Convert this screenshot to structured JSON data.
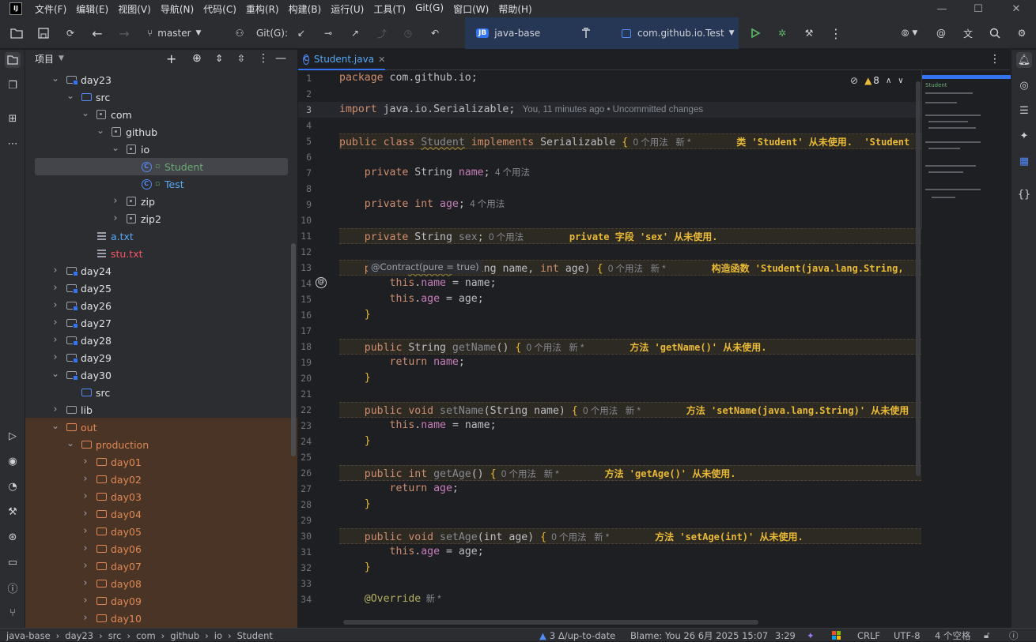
{
  "menu": [
    "文件(F)",
    "编辑(E)",
    "视图(V)",
    "导航(N)",
    "代码(C)",
    "重构(R)",
    "构建(B)",
    "运行(U)",
    "工具(T)",
    "Git(G)",
    "窗口(W)",
    "帮助(H)"
  ],
  "toolbar": {
    "branch": "master",
    "git_label": "Git(G):",
    "project_badge": "JB",
    "project_name": "java-base",
    "run_config": "com.github.io.Test"
  },
  "project_panel": {
    "title": "项目",
    "tree": [
      {
        "label": "day23",
        "type": "module",
        "depth": 1,
        "expanded": true,
        "color": "#dfe1e5"
      },
      {
        "label": "src",
        "type": "folder",
        "depth": 2,
        "expanded": true,
        "color": "#dfe1e5"
      },
      {
        "label": "com",
        "type": "package",
        "depth": 3,
        "expanded": true,
        "color": "#dfe1e5"
      },
      {
        "label": "github",
        "type": "package",
        "depth": 4,
        "expanded": true,
        "color": "#dfe1e5"
      },
      {
        "label": "io",
        "type": "package",
        "depth": 5,
        "expanded": true,
        "color": "#dfe1e5"
      },
      {
        "label": "Student",
        "type": "class",
        "depth": 6,
        "selected": true,
        "color": "#6aab73"
      },
      {
        "label": "Test",
        "type": "class",
        "depth": 6,
        "color": "#56a8f5"
      },
      {
        "label": "zip",
        "type": "package",
        "depth": 5,
        "expanded": false,
        "color": "#dfe1e5"
      },
      {
        "label": "zip2",
        "type": "package",
        "depth": 5,
        "expanded": false,
        "color": "#dfe1e5"
      },
      {
        "label": "a.txt",
        "type": "text",
        "depth": 3,
        "color": "#56a8f5"
      },
      {
        "label": "stu.txt",
        "type": "text",
        "depth": 3,
        "color": "#f75464"
      },
      {
        "label": "day24",
        "type": "module",
        "depth": 1,
        "expanded": false,
        "color": "#dfe1e5"
      },
      {
        "label": "day25",
        "type": "module",
        "depth": 1,
        "expanded": false,
        "color": "#dfe1e5"
      },
      {
        "label": "day26",
        "type": "module",
        "depth": 1,
        "expanded": false,
        "color": "#dfe1e5"
      },
      {
        "label": "day27",
        "type": "module",
        "depth": 1,
        "expanded": false,
        "color": "#dfe1e5"
      },
      {
        "label": "day28",
        "type": "module",
        "depth": 1,
        "expanded": false,
        "color": "#dfe1e5"
      },
      {
        "label": "day29",
        "type": "module",
        "depth": 1,
        "expanded": false,
        "color": "#dfe1e5"
      },
      {
        "label": "day30",
        "type": "module",
        "depth": 1,
        "expanded": true,
        "color": "#dfe1e5"
      },
      {
        "label": "src",
        "type": "folder",
        "depth": 2,
        "color": "#dfe1e5"
      },
      {
        "label": "lib",
        "type": "folder",
        "depth": 1,
        "expanded": false,
        "color": "#dfe1e5"
      },
      {
        "label": "out",
        "type": "folder-orange",
        "depth": 1,
        "expanded": true,
        "color": "#e08855"
      },
      {
        "label": "production",
        "type": "folder-orange",
        "depth": 2,
        "expanded": true,
        "color": "#e08855"
      },
      {
        "label": "day01",
        "type": "folder-orange",
        "depth": 3,
        "expanded": false,
        "color": "#e08855"
      },
      {
        "label": "day02",
        "type": "folder-orange",
        "depth": 3,
        "expanded": false,
        "color": "#e08855"
      },
      {
        "label": "day03",
        "type": "folder-orange",
        "depth": 3,
        "expanded": false,
        "color": "#e08855"
      },
      {
        "label": "day04",
        "type": "folder-orange",
        "depth": 3,
        "expanded": false,
        "color": "#e08855"
      },
      {
        "label": "day05",
        "type": "folder-orange",
        "depth": 3,
        "expanded": false,
        "color": "#e08855"
      },
      {
        "label": "day06",
        "type": "folder-orange",
        "depth": 3,
        "expanded": false,
        "color": "#e08855"
      },
      {
        "label": "day07",
        "type": "folder-orange",
        "depth": 3,
        "expanded": false,
        "color": "#e08855"
      },
      {
        "label": "day08",
        "type": "folder-orange",
        "depth": 3,
        "expanded": false,
        "color": "#e08855"
      },
      {
        "label": "day09",
        "type": "folder-orange",
        "depth": 3,
        "expanded": false,
        "color": "#e08855"
      },
      {
        "label": "day10",
        "type": "folder-orange",
        "depth": 3,
        "expanded": false,
        "color": "#e08855"
      }
    ]
  },
  "editor": {
    "tab_label": "Student.java",
    "warnings_count": "8",
    "contract_hint": "@Contract(pure = true)",
    "line_numbers": [
      "1",
      "2",
      "3",
      "4",
      "5",
      "6",
      "7",
      "8",
      "9",
      "10",
      "11",
      "12",
      "13",
      "14",
      "15",
      "16",
      "17",
      "18",
      "19",
      "20",
      "21",
      "22",
      "23",
      "24",
      "25",
      "26",
      "27",
      "28",
      "29",
      "30",
      "31",
      "32",
      "33",
      "34"
    ],
    "lines": [
      {
        "segs": [
          [
            "kw",
            "package "
          ],
          [
            "ty",
            "com.github.io;"
          ]
        ]
      },
      {
        "segs": []
      },
      {
        "segs": [
          [
            "kw",
            "import "
          ],
          [
            "ty",
            "java.io.Serializable;"
          ],
          [
            "hint",
            "   You, 11 minutes ago • Uncommitted changes"
          ]
        ]
      },
      {
        "segs": []
      },
      {
        "warnline": true,
        "segs": [
          [
            "kw",
            "public class "
          ],
          [
            "uu",
            "Student"
          ],
          [
            "kw",
            " implements "
          ],
          [
            "ty",
            "Serializable "
          ],
          [
            "br",
            "{"
          ],
          [
            "hint",
            "  0 个用法   新 *"
          ],
          [
            "warn",
            "        类 'Student' 从未使用.  'Student"
          ]
        ]
      },
      {
        "segs": []
      },
      {
        "segs": [
          [
            "kw",
            "    private "
          ],
          [
            "ty",
            "String "
          ],
          [
            "fld",
            "name"
          ],
          [
            "ty",
            ";"
          ],
          [
            "hint",
            "  4 个用法"
          ]
        ]
      },
      {
        "segs": []
      },
      {
        "segs": [
          [
            "kw",
            "    private int "
          ],
          [
            "fld",
            "age"
          ],
          [
            "ty",
            ";"
          ],
          [
            "hint",
            "  4 个用法"
          ]
        ]
      },
      {
        "segs": []
      },
      {
        "warnline": true,
        "segs": [
          [
            "kw",
            "    private "
          ],
          [
            "ty",
            "String "
          ],
          [
            "uu",
            "sex"
          ],
          [
            "ty",
            ";"
          ],
          [
            "hint",
            "  0 个用法"
          ],
          [
            "warn",
            "        private 字段 'sex' 从未使用."
          ]
        ]
      },
      {
        "segs": []
      },
      {
        "warnline": true,
        "segs": [
          [
            "kw",
            "    public "
          ],
          [
            "uu",
            "Student"
          ],
          [
            "ty",
            "("
          ],
          [
            "ty",
            "String name, "
          ],
          [
            "kw",
            "int "
          ],
          [
            "ty",
            "age) "
          ],
          [
            "br",
            "{"
          ],
          [
            "hint",
            "  0 个用法   新 *"
          ],
          [
            "warn",
            "        构造函数 'Student(java.lang.String,"
          ]
        ]
      },
      {
        "segs": [
          [
            "kw",
            "        this"
          ],
          [
            "ty",
            "."
          ],
          [
            "fld",
            "name"
          ],
          [
            "ty",
            " = name;"
          ]
        ]
      },
      {
        "segs": [
          [
            "kw",
            "        this"
          ],
          [
            "ty",
            "."
          ],
          [
            "fld",
            "age"
          ],
          [
            "ty",
            " = age;"
          ]
        ]
      },
      {
        "segs": [
          [
            "br",
            "    }"
          ]
        ]
      },
      {
        "segs": []
      },
      {
        "warnline": true,
        "segs": [
          [
            "kw",
            "    public "
          ],
          [
            "ty",
            "String "
          ],
          [
            "uu",
            "getName"
          ],
          [
            "ty",
            "() "
          ],
          [
            "br",
            "{"
          ],
          [
            "hint",
            "  0 个用法   新 *"
          ],
          [
            "warn",
            "        方法 'getName()' 从未使用."
          ]
        ]
      },
      {
        "segs": [
          [
            "kw",
            "        return "
          ],
          [
            "fld",
            "name"
          ],
          [
            "ty",
            ";"
          ]
        ]
      },
      {
        "segs": [
          [
            "br",
            "    }"
          ]
        ]
      },
      {
        "segs": []
      },
      {
        "warnline": true,
        "segs": [
          [
            "kw",
            "    public void "
          ],
          [
            "uu",
            "setName"
          ],
          [
            "ty",
            "(String name) "
          ],
          [
            "br",
            "{"
          ],
          [
            "hint",
            "  0 个用法   新 *"
          ],
          [
            "warn",
            "        方法 'setName(java.lang.String)' 从未使用"
          ]
        ]
      },
      {
        "segs": [
          [
            "kw",
            "        this"
          ],
          [
            "ty",
            "."
          ],
          [
            "fld",
            "name"
          ],
          [
            "ty",
            " = name;"
          ]
        ]
      },
      {
        "segs": [
          [
            "br",
            "    }"
          ]
        ]
      },
      {
        "segs": []
      },
      {
        "warnline": true,
        "segs": [
          [
            "kw",
            "    public int "
          ],
          [
            "uu",
            "getAge"
          ],
          [
            "ty",
            "() "
          ],
          [
            "br",
            "{"
          ],
          [
            "hint",
            "  0 个用法   新 *"
          ],
          [
            "warn",
            "        方法 'getAge()' 从未使用."
          ]
        ]
      },
      {
        "segs": [
          [
            "kw",
            "        return "
          ],
          [
            "fld",
            "age"
          ],
          [
            "ty",
            ";"
          ]
        ]
      },
      {
        "segs": [
          [
            "br",
            "    }"
          ]
        ]
      },
      {
        "segs": []
      },
      {
        "warnline": true,
        "segs": [
          [
            "kw",
            "    public void "
          ],
          [
            "uu",
            "setAge"
          ],
          [
            "ty",
            "(int age) "
          ],
          [
            "br",
            "{"
          ],
          [
            "hint",
            "  0 个用法   新 *"
          ],
          [
            "warn",
            "        方法 'setAge(int)' 从未使用."
          ]
        ]
      },
      {
        "segs": [
          [
            "kw",
            "        this"
          ],
          [
            "ty",
            "."
          ],
          [
            "fld",
            "age"
          ],
          [
            "ty",
            " = age;"
          ]
        ]
      },
      {
        "segs": [
          [
            "br",
            "    }"
          ]
        ]
      },
      {
        "segs": []
      },
      {
        "segs": [
          [
            "an",
            "    @Override"
          ],
          [
            "hint",
            "  新 *"
          ]
        ]
      }
    ]
  },
  "minimap": {
    "label": "Student"
  },
  "status": {
    "breadcrumbs": [
      "java-base",
      "day23",
      "src",
      "com",
      "github",
      "io",
      "Student"
    ],
    "vcs": "3 Δ/up-to-date",
    "blame": "Blame: You 26 6月 2025 15:07",
    "position": "3:29",
    "line_sep": "CRLF",
    "encoding": "UTF-8",
    "indent": "4 个空格"
  },
  "colors": {
    "accent": "#3574f0",
    "excluded": "#e08855",
    "class_green": "#6aab73"
  }
}
